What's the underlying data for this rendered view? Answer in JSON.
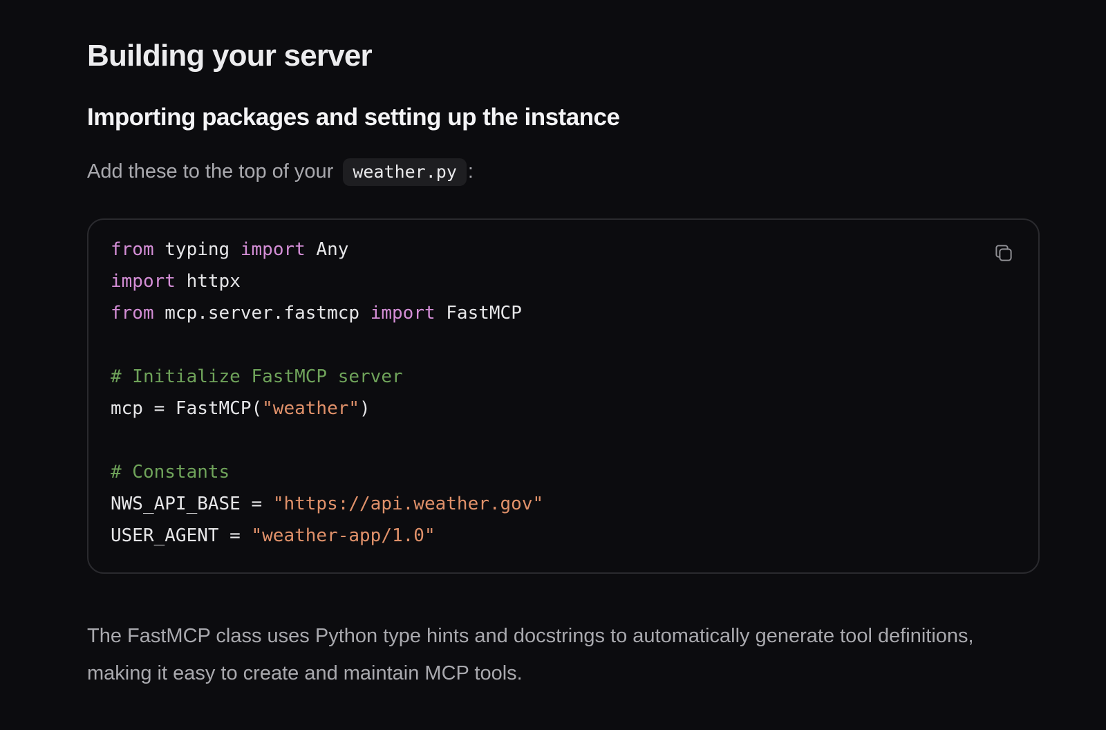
{
  "title": "Building your server",
  "subtitle": "Importing packages and setting up the instance",
  "intro": {
    "text": "Add these to the top of your",
    "filename": "weather.py",
    "suffix": ":"
  },
  "code_block": {
    "copy_icon": "copy-icon",
    "lines": {
      "l1": {
        "a": "from",
        "b": " typing ",
        "c": "import",
        "d": " Any"
      },
      "l2": {
        "a": "import",
        "b": " httpx"
      },
      "l3": {
        "a": "from",
        "b": " mcp.server.fastmcp ",
        "c": "import",
        "d": " FastMCP"
      },
      "l5": {
        "comment": "# Initialize FastMCP server"
      },
      "l6": {
        "a": "mcp = FastMCP(",
        "s": "\"weather\"",
        "b": ")"
      },
      "l8": {
        "comment": "# Constants"
      },
      "l9": {
        "a": "NWS_API_BASE = ",
        "s": "\"https://api.weather.gov\""
      },
      "l10": {
        "a": "USER_AGENT = ",
        "s": "\"weather-app/1.0\""
      }
    }
  },
  "outro": "The FastMCP class uses Python type hints and docstrings to automatically generate tool definitions, making it easy to create and maintain MCP tools.",
  "colors": {
    "background": "#0c0c0f",
    "keyword": "#d48ed6",
    "comment": "#6fa35a",
    "string": "#e0916a"
  }
}
